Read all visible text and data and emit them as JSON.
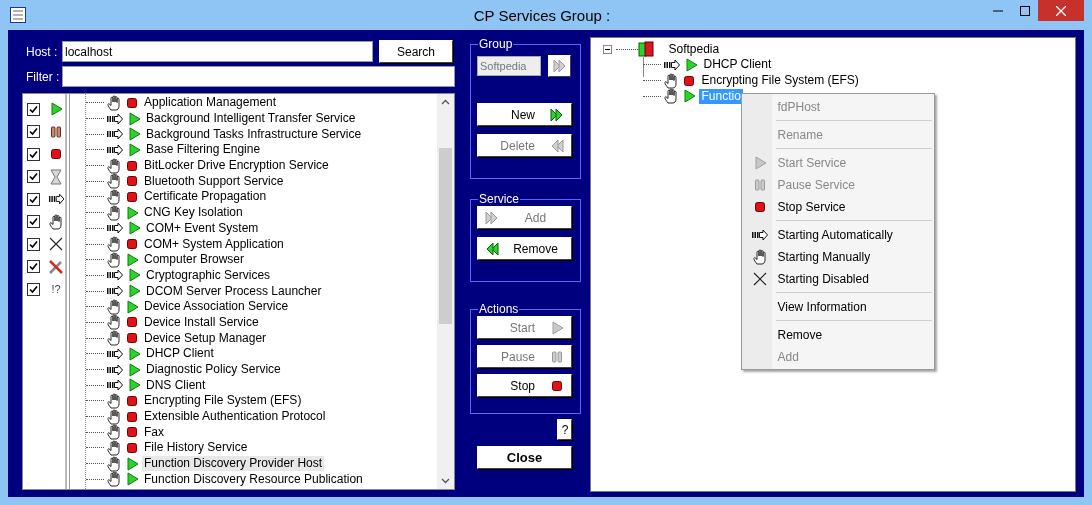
{
  "window": {
    "title": "CP Services Group :"
  },
  "host": {
    "label": "Host :",
    "value": "localhost",
    "button": "Search"
  },
  "filter": {
    "label": "Filter :"
  },
  "filters": [
    {
      "kind": "running",
      "checked": true
    },
    {
      "kind": "paused",
      "checked": true
    },
    {
      "kind": "stopped",
      "checked": true
    },
    {
      "kind": "pending",
      "checked": true
    },
    {
      "kind": "auto",
      "checked": true
    },
    {
      "kind": "manual",
      "checked": true
    },
    {
      "kind": "disabled",
      "checked": true
    },
    {
      "kind": "tools",
      "checked": true
    },
    {
      "kind": "unknown",
      "checked": true,
      "label": "!?"
    }
  ],
  "services": [
    {
      "name": "Application Management",
      "auto_start": false,
      "running": false,
      "selected": false
    },
    {
      "name": "Background Intelligent Transfer Service",
      "auto_start": true,
      "running": true,
      "selected": false
    },
    {
      "name": "Background Tasks Infrastructure Service",
      "auto_start": true,
      "running": true,
      "selected": false
    },
    {
      "name": "Base Filtering Engine",
      "auto_start": true,
      "running": true,
      "selected": false
    },
    {
      "name": "BitLocker Drive Encryption Service",
      "auto_start": false,
      "running": false,
      "selected": false
    },
    {
      "name": "Bluetooth Support Service",
      "auto_start": false,
      "running": false,
      "selected": false
    },
    {
      "name": "Certificate Propagation",
      "auto_start": false,
      "running": false,
      "selected": false
    },
    {
      "name": "CNG Key Isolation",
      "auto_start": false,
      "running": true,
      "selected": false
    },
    {
      "name": "COM+ Event System",
      "auto_start": true,
      "running": true,
      "selected": false
    },
    {
      "name": "COM+ System Application",
      "auto_start": false,
      "running": false,
      "selected": false
    },
    {
      "name": "Computer Browser",
      "auto_start": false,
      "running": true,
      "selected": false
    },
    {
      "name": "Cryptographic Services",
      "auto_start": true,
      "running": true,
      "selected": false
    },
    {
      "name": "DCOM Server Process Launcher",
      "auto_start": true,
      "running": true,
      "selected": false
    },
    {
      "name": "Device Association Service",
      "auto_start": false,
      "running": true,
      "selected": false
    },
    {
      "name": "Device Install Service",
      "auto_start": false,
      "running": false,
      "selected": false
    },
    {
      "name": "Device Setup Manager",
      "auto_start": false,
      "running": false,
      "selected": false
    },
    {
      "name": "DHCP Client",
      "auto_start": true,
      "running": true,
      "selected": false
    },
    {
      "name": "Diagnostic Policy Service",
      "auto_start": true,
      "running": true,
      "selected": false
    },
    {
      "name": "DNS Client",
      "auto_start": true,
      "running": true,
      "selected": false
    },
    {
      "name": "Encrypting File System (EFS)",
      "auto_start": false,
      "running": false,
      "selected": false
    },
    {
      "name": "Extensible Authentication Protocol",
      "auto_start": false,
      "running": false,
      "selected": false
    },
    {
      "name": "Fax",
      "auto_start": false,
      "running": false,
      "selected": false
    },
    {
      "name": "File History Service",
      "auto_start": false,
      "running": false,
      "selected": false
    },
    {
      "name": "Function Discovery Provider Host",
      "auto_start": false,
      "running": true,
      "selected": true
    },
    {
      "name": "Function Discovery Resource Publication",
      "auto_start": false,
      "running": true,
      "selected": false
    }
  ],
  "group_panel": {
    "title": "Group",
    "name": "Softpedia",
    "select_button": {
      "disabled": true
    },
    "buttons": [
      {
        "label": "New",
        "kind": "new",
        "disabled": false
      },
      {
        "label": "Delete",
        "kind": "delete",
        "disabled": true
      }
    ]
  },
  "panels": [
    {
      "title": "Service",
      "buttons": [
        {
          "label": "Add",
          "kind": "add",
          "disabled": true
        },
        {
          "label": "Remove",
          "kind": "remove",
          "disabled": false
        }
      ]
    },
    {
      "title": "Actions",
      "buttons": [
        {
          "label": "Start",
          "kind": "start",
          "disabled": true
        },
        {
          "label": "Pause",
          "kind": "pause",
          "disabled": true
        },
        {
          "label": "Stop",
          "kind": "stop",
          "disabled": false
        }
      ]
    }
  ],
  "help_button": "?",
  "close_button": "Close",
  "group_tree": {
    "name": "Softpedia",
    "expanded": true,
    "children": [
      {
        "name": "DHCP Client",
        "auto_start": true,
        "running": true,
        "selected": false
      },
      {
        "name": "Encrypting File System (EFS)",
        "auto_start": false,
        "running": false,
        "selected": false
      },
      {
        "name": "Functio",
        "auto_start": false,
        "running": true,
        "selected": true
      }
    ]
  },
  "context_menu": {
    "groups": [
      [
        {
          "label": "fdPHost",
          "kind": "header",
          "disabled": true
        }
      ],
      [
        {
          "label": "Rename",
          "kind": "rename",
          "disabled": true
        }
      ],
      [
        {
          "label": "Start Service",
          "kind": "start",
          "disabled": true
        },
        {
          "label": "Pause Service",
          "kind": "pause",
          "disabled": true
        },
        {
          "label": "Stop Service",
          "kind": "stop",
          "disabled": false
        }
      ],
      [
        {
          "label": "Starting Automatically",
          "kind": "auto",
          "disabled": false
        },
        {
          "label": "Starting Manually",
          "kind": "manual",
          "disabled": false
        },
        {
          "label": "Starting Disabled",
          "kind": "disabled",
          "disabled": false
        }
      ],
      [
        {
          "label": "View Information",
          "kind": "info",
          "disabled": false
        }
      ],
      [
        {
          "label": "Remove",
          "kind": "remove",
          "disabled": false
        },
        {
          "label": "Add",
          "kind": "add",
          "disabled": true
        }
      ]
    ]
  }
}
